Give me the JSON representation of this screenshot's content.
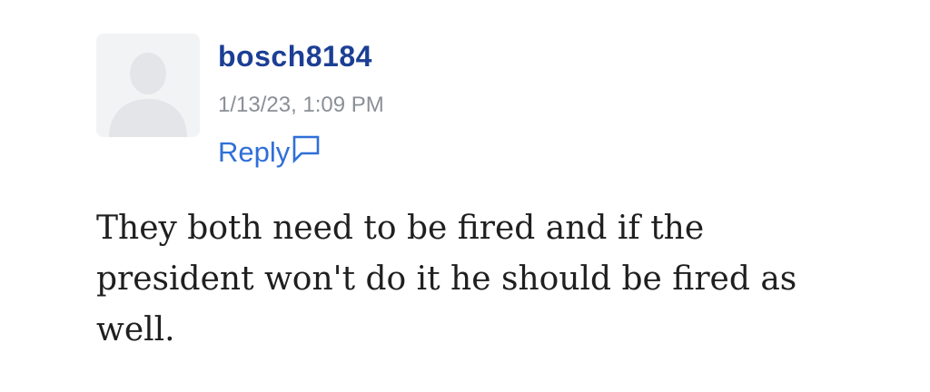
{
  "comment": {
    "avatar_icon": "default-user-avatar",
    "username": "bosch8184",
    "timestamp": "1/13/23, 1:09 PM",
    "reply_label": "Reply",
    "reply_icon": "speech-bubble-icon",
    "body": "They both need to be fired and if the president won't do it he should be fired as well."
  },
  "colors": {
    "username": "#1c3f95",
    "timestamp": "#8a8f96",
    "reply": "#2f6fd8",
    "body_text": "#1f1f1f",
    "avatar_bg": "#f2f3f5",
    "avatar_silhouette": "#e3e5e8"
  }
}
